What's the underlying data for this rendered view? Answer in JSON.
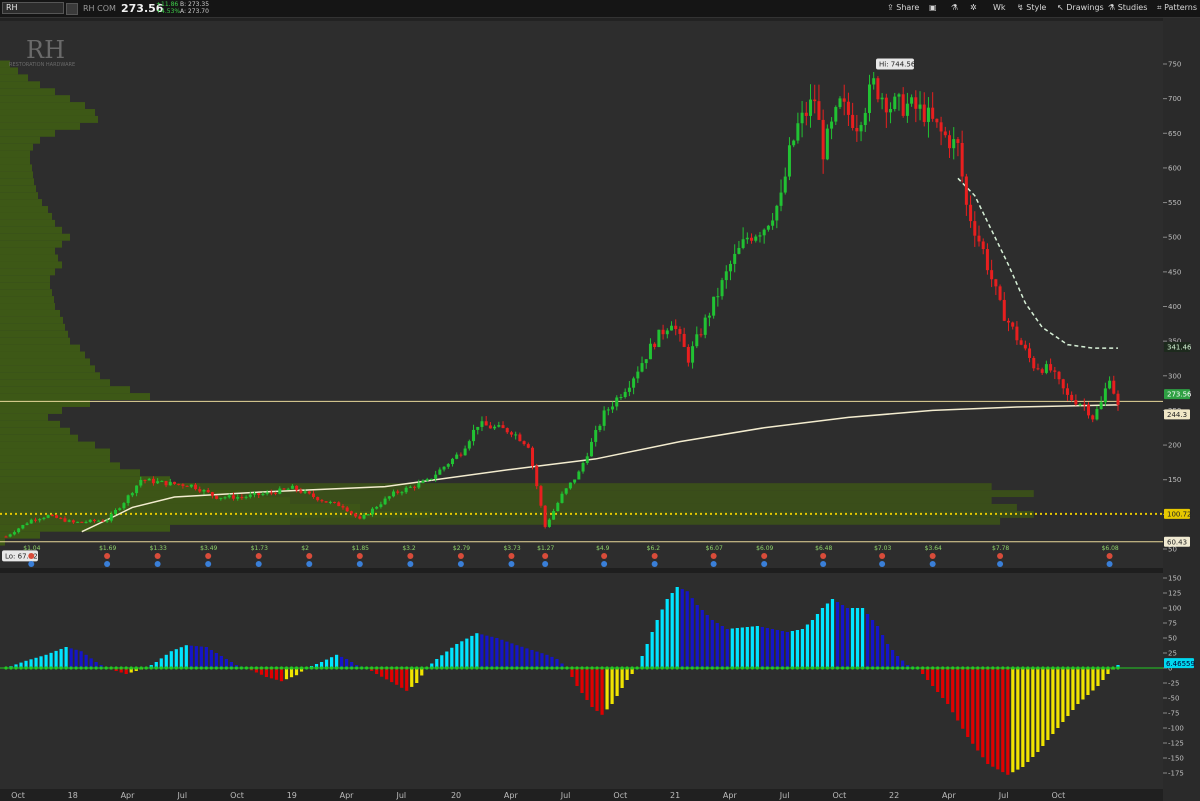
{
  "toolbar": {
    "symbol": "RH",
    "company": "RH COM",
    "last": "273.56",
    "change": "+11.86",
    "change_pct": "+4.53%",
    "bid": "B: 273.35",
    "ask": "A: 273.70",
    "share_label": "Share",
    "wk_label": "Wk",
    "style_label": "Style",
    "drawings_label": "Drawings",
    "studies_label": "Studies",
    "patterns_label": "Patterns"
  },
  "watermark": {
    "logo": "RH",
    "name": "RESTORATION HARDWARE"
  },
  "chart_data": [
    {
      "type": "candlestick",
      "title": "RH",
      "timeframe": "Wk",
      "ylim": [
        50,
        770
      ],
      "y_ticks": [
        50,
        100,
        150,
        200,
        250,
        300,
        350,
        400,
        450,
        500,
        550,
        600,
        650,
        700,
        750
      ],
      "x_tick_labels": [
        "Oct",
        "18",
        "Apr",
        "Jul",
        "Oct",
        "19",
        "Apr",
        "Jul",
        "20",
        "Apr",
        "Jul",
        "Oct",
        "21",
        "Apr",
        "Jul",
        "Oct",
        "22",
        "Apr",
        "Jul",
        "Oct"
      ],
      "x_ticks_time": [
        0,
        13,
        26,
        39,
        52,
        65,
        78,
        91,
        104,
        117,
        130,
        143,
        156,
        169,
        182,
        195,
        208,
        221,
        234,
        247
      ],
      "close_series": [
        [
          0,
          68
        ],
        [
          6,
          92
        ],
        [
          10,
          98
        ],
        [
          16,
          88
        ],
        [
          24,
          92
        ],
        [
          28,
          118
        ],
        [
          32,
          150
        ],
        [
          38,
          145
        ],
        [
          44,
          142
        ],
        [
          50,
          125
        ],
        [
          56,
          125
        ],
        [
          62,
          130
        ],
        [
          68,
          138
        ],
        [
          76,
          118
        ],
        [
          80,
          112
        ],
        [
          84,
          92
        ],
        [
          88,
          112
        ],
        [
          92,
          130
        ],
        [
          100,
          148
        ],
        [
          108,
          190
        ],
        [
          112,
          230
        ],
        [
          120,
          220
        ],
        [
          124,
          200
        ],
        [
          128,
          82
        ],
        [
          132,
          128
        ],
        [
          136,
          160
        ],
        [
          142,
          245
        ],
        [
          148,
          290
        ],
        [
          154,
          350
        ],
        [
          158,
          380
        ],
        [
          162,
          325
        ],
        [
          168,
          405
        ],
        [
          172,
          460
        ],
        [
          176,
          500
        ],
        [
          180,
          515
        ],
        [
          184,
          555
        ],
        [
          186,
          620
        ],
        [
          188,
          660
        ],
        [
          192,
          700
        ],
        [
          194,
          625
        ],
        [
          198,
          690
        ],
        [
          202,
          665
        ],
        [
          206,
          720
        ],
        [
          210,
          690
        ],
        [
          214,
          690
        ],
        [
          218,
          680
        ],
        [
          222,
          650
        ],
        [
          226,
          630
        ],
        [
          228,
          545
        ],
        [
          232,
          480
        ],
        [
          236,
          400
        ],
        [
          240,
          355
        ],
        [
          244,
          315
        ],
        [
          248,
          308
        ],
        [
          252,
          270
        ],
        [
          256,
          258
        ],
        [
          258,
          240
        ],
        [
          260,
          260
        ],
        [
          262,
          300
        ],
        [
          264,
          255
        ]
      ],
      "high_label": "Hi: 744.56",
      "low_label": "Lo: 67.72",
      "sma_long": [
        [
          18,
          75
        ],
        [
          26,
          98
        ],
        [
          30,
          110
        ],
        [
          40,
          125
        ],
        [
          60,
          132
        ],
        [
          90,
          140
        ],
        [
          120,
          165
        ],
        [
          140,
          180
        ],
        [
          160,
          205
        ],
        [
          180,
          225
        ],
        [
          200,
          240
        ],
        [
          220,
          250
        ],
        [
          240,
          255
        ],
        [
          264,
          258
        ]
      ],
      "sma_dashed": [
        [
          226,
          585
        ],
        [
          230,
          560
        ],
        [
          234,
          510
        ],
        [
          238,
          460
        ],
        [
          242,
          405
        ],
        [
          246,
          370
        ],
        [
          252,
          345
        ],
        [
          258,
          340
        ],
        [
          264,
          340
        ]
      ],
      "horizontal_lines": [
        {
          "value": 263,
          "color": "#e8d89a",
          "style": "solid"
        },
        {
          "value": 100.72,
          "color": "#e6c800",
          "style": "dotted"
        },
        {
          "value": 60.43,
          "color": "#e8d89a",
          "style": "solid"
        }
      ],
      "price_tags": [
        {
          "value": 341.46,
          "label": "341.46",
          "bg": "#1d2a1d",
          "fg": "#d0f0d0"
        },
        {
          "value": 273.56,
          "label": "273.56",
          "bg": "#2ea043",
          "fg": "#ffffff"
        },
        {
          "value": 244.3,
          "label": "244.3",
          "bg": "#efe6c6",
          "fg": "#222222"
        },
        {
          "value": 100.72,
          "label": "100.72",
          "bg": "#e6c800",
          "fg": "#222222"
        },
        {
          "value": 60.43,
          "label": "60.43",
          "bg": "#f0ead2",
          "fg": "#222222"
        }
      ],
      "volume_profile": [
        [
          60,
          5
        ],
        [
          70,
          40
        ],
        [
          80,
          170
        ],
        [
          90,
          290
        ],
        [
          100,
          430
        ],
        [
          110,
          360
        ],
        [
          120,
          290
        ],
        [
          130,
          240
        ],
        [
          140,
          200
        ],
        [
          150,
          170
        ],
        [
          160,
          140
        ],
        [
          170,
          120
        ],
        [
          180,
          110
        ],
        [
          190,
          110
        ],
        [
          200,
          95
        ],
        [
          210,
          78
        ],
        [
          220,
          70
        ],
        [
          230,
          60
        ],
        [
          240,
          48
        ],
        [
          250,
          62
        ],
        [
          260,
          90
        ],
        [
          270,
          150
        ],
        [
          280,
          130
        ],
        [
          290,
          110
        ],
        [
          300,
          100
        ],
        [
          310,
          95
        ],
        [
          320,
          90
        ],
        [
          330,
          85
        ],
        [
          340,
          80
        ],
        [
          350,
          70
        ],
        [
          360,
          68
        ],
        [
          370,
          65
        ],
        [
          380,
          63
        ],
        [
          390,
          60
        ],
        [
          400,
          55
        ],
        [
          410,
          54
        ],
        [
          420,
          52
        ],
        [
          430,
          50
        ],
        [
          440,
          50
        ],
        [
          450,
          55
        ],
        [
          460,
          62
        ],
        [
          470,
          58
        ],
        [
          480,
          55
        ],
        [
          490,
          62
        ],
        [
          500,
          70
        ],
        [
          510,
          62
        ],
        [
          520,
          55
        ],
        [
          530,
          52
        ],
        [
          540,
          48
        ],
        [
          550,
          42
        ],
        [
          560,
          38
        ],
        [
          570,
          36
        ],
        [
          580,
          34
        ],
        [
          590,
          33
        ],
        [
          600,
          32
        ],
        [
          610,
          30
        ],
        [
          620,
          30
        ],
        [
          630,
          33
        ],
        [
          640,
          40
        ],
        [
          650,
          55
        ],
        [
          660,
          80
        ],
        [
          670,
          98
        ],
        [
          680,
          95
        ],
        [
          690,
          85
        ],
        [
          700,
          70
        ],
        [
          710,
          55
        ],
        [
          720,
          40
        ],
        [
          730,
          28
        ],
        [
          740,
          18
        ],
        [
          750,
          10
        ]
      ],
      "volume_profile_extended": [
        {
          "value": 140,
          "right_time": 234
        },
        {
          "value": 130,
          "right_time": 244
        },
        {
          "value": 120,
          "right_time": 234
        },
        {
          "value": 110,
          "right_time": 240
        },
        {
          "value": 100,
          "right_time": 244
        },
        {
          "value": 90,
          "right_time": 236
        }
      ],
      "events": [
        {
          "t": 6,
          "label": "$1.04"
        },
        {
          "t": 24,
          "label": "$1.69"
        },
        {
          "t": 36,
          "label": "$1.33"
        },
        {
          "t": 48,
          "label": "$3.49"
        },
        {
          "t": 60,
          "label": "$1.73"
        },
        {
          "t": 72,
          "label": "$2"
        },
        {
          "t": 84,
          "label": "$1.85"
        },
        {
          "t": 96,
          "label": "$3.2"
        },
        {
          "t": 108,
          "label": "$2.79"
        },
        {
          "t": 120,
          "label": "$3.73"
        },
        {
          "t": 128,
          "label": "$1.27"
        },
        {
          "t": 142,
          "label": "$4.9"
        },
        {
          "t": 154,
          "label": "$6.2"
        },
        {
          "t": 168,
          "label": "$6.07"
        },
        {
          "t": 180,
          "label": "$6.09"
        },
        {
          "t": 194,
          "label": "$6.48"
        },
        {
          "t": 208,
          "label": "$7.03"
        },
        {
          "t": 220,
          "label": "$3.64"
        },
        {
          "t": 236,
          "label": "$7.78"
        },
        {
          "t": 262,
          "label": "$6.08"
        }
      ]
    },
    {
      "type": "bar",
      "title": "",
      "ylim": [
        -190,
        155
      ],
      "y_ticks": [
        150,
        125,
        100,
        75,
        50,
        25,
        0,
        -25,
        -50,
        -75,
        -100,
        -125,
        -150,
        -175
      ],
      "last_value_label": "6.46559",
      "histogram_keyframes": [
        [
          0,
          0
        ],
        [
          4,
          12
        ],
        [
          8,
          22
        ],
        [
          12,
          35
        ],
        [
          15,
          28
        ],
        [
          18,
          10
        ],
        [
          20,
          0
        ],
        [
          22,
          -5
        ],
        [
          24,
          -10
        ],
        [
          26,
          -5
        ],
        [
          28,
          0
        ],
        [
          30,
          10
        ],
        [
          33,
          28
        ],
        [
          36,
          38
        ],
        [
          40,
          35
        ],
        [
          43,
          20
        ],
        [
          46,
          5
        ],
        [
          48,
          0
        ],
        [
          52,
          -15
        ],
        [
          55,
          -22
        ],
        [
          58,
          -12
        ],
        [
          60,
          0
        ],
        [
          63,
          10
        ],
        [
          66,
          22
        ],
        [
          68,
          15
        ],
        [
          70,
          5
        ],
        [
          72,
          0
        ],
        [
          74,
          -10
        ],
        [
          78,
          -28
        ],
        [
          80,
          -38
        ],
        [
          82,
          -25
        ],
        [
          84,
          0
        ],
        [
          86,
          15
        ],
        [
          90,
          40
        ],
        [
          94,
          58
        ],
        [
          98,
          50
        ],
        [
          102,
          38
        ],
        [
          105,
          30
        ],
        [
          108,
          22
        ],
        [
          110,
          15
        ],
        [
          112,
          0
        ],
        [
          114,
          -30
        ],
        [
          117,
          -65
        ],
        [
          119,
          -78
        ],
        [
          121,
          -60
        ],
        [
          124,
          -20
        ],
        [
          126,
          0
        ],
        [
          128,
          40
        ],
        [
          130,
          80
        ],
        [
          132,
          115
        ],
        [
          134,
          135
        ],
        [
          136,
          128
        ],
        [
          138,
          105
        ],
        [
          141,
          80
        ],
        [
          144,
          65
        ],
        [
          150,
          70
        ],
        [
          156,
          60
        ],
        [
          159,
          65
        ],
        [
          161,
          80
        ],
        [
          163,
          100
        ],
        [
          165,
          115
        ],
        [
          168,
          100
        ],
        [
          171,
          100
        ],
        [
          174,
          70
        ],
        [
          176,
          40
        ],
        [
          178,
          20
        ],
        [
          180,
          5
        ],
        [
          182,
          0
        ],
        [
          184,
          -20
        ],
        [
          188,
          -60
        ],
        [
          192,
          -115
        ],
        [
          196,
          -160
        ],
        [
          200,
          -178
        ],
        [
          203,
          -165
        ],
        [
          206,
          -140
        ],
        [
          210,
          -100
        ],
        [
          214,
          -60
        ],
        [
          218,
          -30
        ],
        [
          220,
          -10
        ],
        [
          222,
          5
        ]
      ],
      "bar_colors": {
        "pos_up": "#00e5ff",
        "pos_down": "#1515c8",
        "neg_down": "#e00000",
        "neg_up": "#f0e400"
      },
      "zero_line_color": "#22cc22"
    }
  ]
}
